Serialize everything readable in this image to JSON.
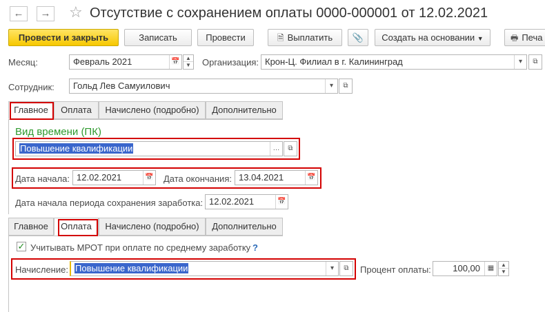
{
  "window": {
    "title": "Отсутствие с сохранением оплаты 0000-000001 от 12.02.2021",
    "back_icon": "arrow-left",
    "forward_icon": "arrow-right",
    "favorite_icon": "star"
  },
  "toolbar": {
    "post_close": "Провести и закрыть",
    "save": "Записать",
    "post": "Провести",
    "pay": "Выплатить",
    "create_based_on": "Создать на основании",
    "print": "Печа"
  },
  "header": {
    "month_label": "Месяц:",
    "month_value": "Февраль 2021",
    "org_label": "Организация:",
    "org_value": "Крон-Ц. Филиал в г. Калининград",
    "employee_label": "Сотрудник:",
    "employee_value": "Гольд Лев Самуилович"
  },
  "tabs_main": {
    "items": [
      "Главное",
      "Оплата",
      "Начислено (подробно)",
      "Дополнительно"
    ],
    "active": "Главное"
  },
  "main_tab": {
    "section_title": "Вид времени (ПК)",
    "time_type_value": "Повышение квалификации",
    "start_label": "Дата начала:",
    "start_value": "12.02.2021",
    "end_label": "Дата окончания:",
    "end_value": "13.04.2021",
    "period_start_label": "Дата начала периода сохранения заработка:",
    "period_start_value": "12.02.2021"
  },
  "tabs_payment": {
    "items": [
      "Главное",
      "Оплата",
      "Начислено (подробно)",
      "Дополнительно"
    ],
    "active": "Оплата"
  },
  "payment_tab": {
    "mrot_label": "Учитывать МРОТ при оплате по среднему заработку",
    "mrot_checked": true,
    "help": "?",
    "accrual_label": "Начисление:",
    "accrual_value": "Повышение квалификации",
    "percent_label": "Процент оплаты:",
    "percent_value": "100,00"
  },
  "colors": {
    "primary_button": "#f7c800",
    "highlight_border": "#d30000",
    "section_title": "#2e9a2e",
    "selection": "#3a66cc"
  }
}
